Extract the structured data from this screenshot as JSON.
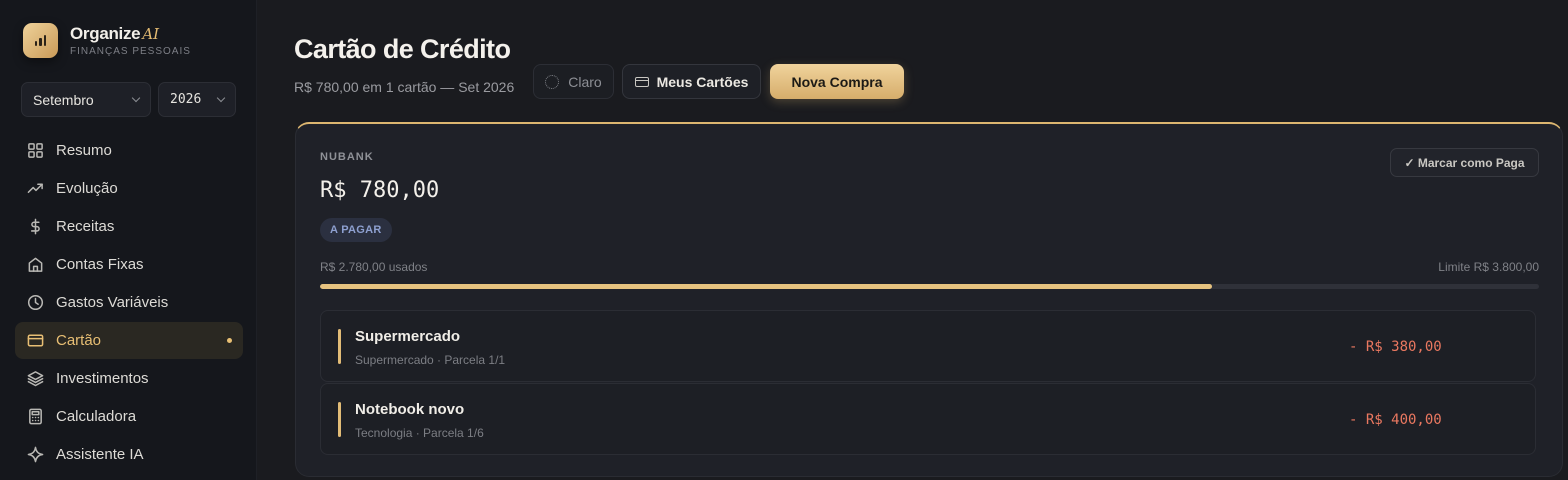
{
  "brand": {
    "name": "Organize",
    "ai": "AI",
    "subtitle": "FINANÇAS PESSOAIS"
  },
  "filters": {
    "month": "Setembro",
    "year": "2026"
  },
  "nav": [
    {
      "label": "Resumo",
      "icon": "grid-icon"
    },
    {
      "label": "Evolução",
      "icon": "trend-icon"
    },
    {
      "label": "Receitas",
      "icon": "dollar-icon"
    },
    {
      "label": "Contas Fixas",
      "icon": "home-icon"
    },
    {
      "label": "Gastos Variáveis",
      "icon": "clock-icon"
    },
    {
      "label": "Cartão",
      "icon": "credit-card-icon",
      "active": true
    },
    {
      "label": "Investimentos",
      "icon": "layers-icon"
    },
    {
      "label": "Calculadora",
      "icon": "calculator-icon"
    },
    {
      "label": "Assistente IA",
      "icon": "sparkle-icon"
    }
  ],
  "header": {
    "title": "Cartão de Crédito",
    "subtitle": "R$ 780,00 em 1 cartão — Set 2026",
    "theme_label": "Claro",
    "cards_label": "Meus Cartões",
    "new_label": "Nova Compra"
  },
  "card": {
    "bank": "NUBANK",
    "amount": "R$ 780,00",
    "status": "A PAGAR",
    "mark_paid_label": "✓ Marcar como Paga",
    "used_label": "R$ 2.780,00 usados",
    "limit_label": "Limite R$ 3.800,00",
    "usage_fraction": 0.7316,
    "purchases": [
      {
        "name": "Supermercado",
        "meta": "Supermercado · Parcela 1/1",
        "value": "- R$ 380,00"
      },
      {
        "name": "Notebook novo",
        "meta": "Tecnologia · Parcela 1/6",
        "value": "- R$ 400,00"
      }
    ]
  },
  "colors": {
    "accent": "#e8bf74",
    "negative": "#ea7860",
    "badge": "#8ea0d0"
  }
}
